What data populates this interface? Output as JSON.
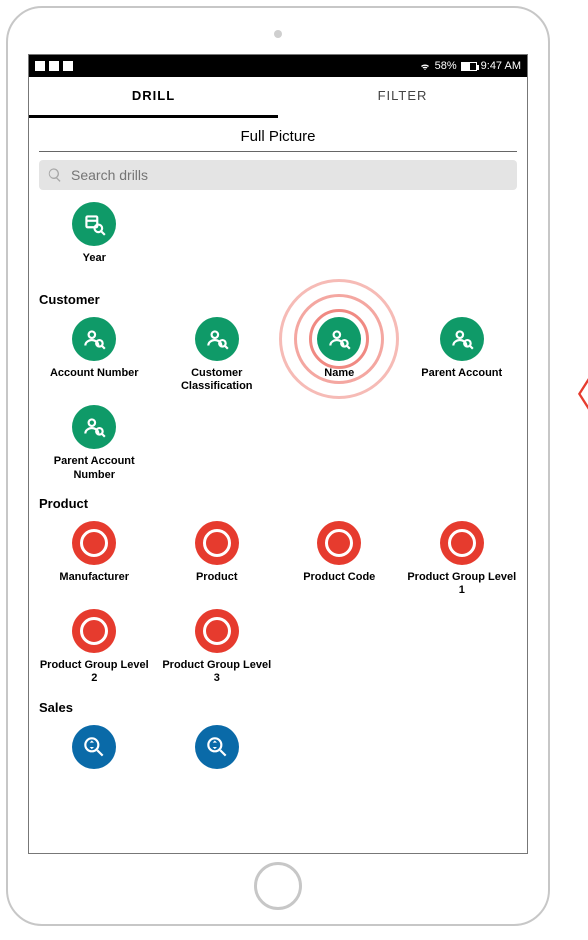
{
  "status": {
    "battery_pct": "58%",
    "time": "9:47 AM"
  },
  "tabs": {
    "drill": "DRILL",
    "filter": "FILTER",
    "active": "drill"
  },
  "page_title": "Full Picture",
  "search": {
    "placeholder": "Search drills"
  },
  "sections": {
    "time": {
      "items": [
        {
          "label": "Year",
          "color": "green",
          "icon": "calendar"
        }
      ]
    },
    "customer": {
      "label": "Customer",
      "items": [
        {
          "label": "Account Number",
          "color": "green",
          "icon": "person"
        },
        {
          "label": "Customer Classification",
          "color": "green",
          "icon": "person"
        },
        {
          "label": "Name",
          "color": "green",
          "icon": "person",
          "highlight": true
        },
        {
          "label": "Parent Account",
          "color": "green",
          "icon": "person"
        },
        {
          "label": "Parent Account Number",
          "color": "green",
          "icon": "person"
        }
      ]
    },
    "product": {
      "label": "Product",
      "items": [
        {
          "label": "Manufacturer",
          "color": "red",
          "icon": "ring"
        },
        {
          "label": "Product",
          "color": "red",
          "icon": "ring"
        },
        {
          "label": "Product Code",
          "color": "red",
          "icon": "ring"
        },
        {
          "label": "Product Group Level 1",
          "color": "red",
          "icon": "ring"
        },
        {
          "label": "Product Group Level 2",
          "color": "red",
          "icon": "ring"
        },
        {
          "label": "Product Group Level 3",
          "color": "red",
          "icon": "ring"
        }
      ]
    },
    "sales": {
      "label": "Sales",
      "items": [
        {
          "label": "",
          "color": "blue",
          "icon": "updown"
        },
        {
          "label": "",
          "color": "blue",
          "icon": "updown"
        }
      ]
    }
  }
}
